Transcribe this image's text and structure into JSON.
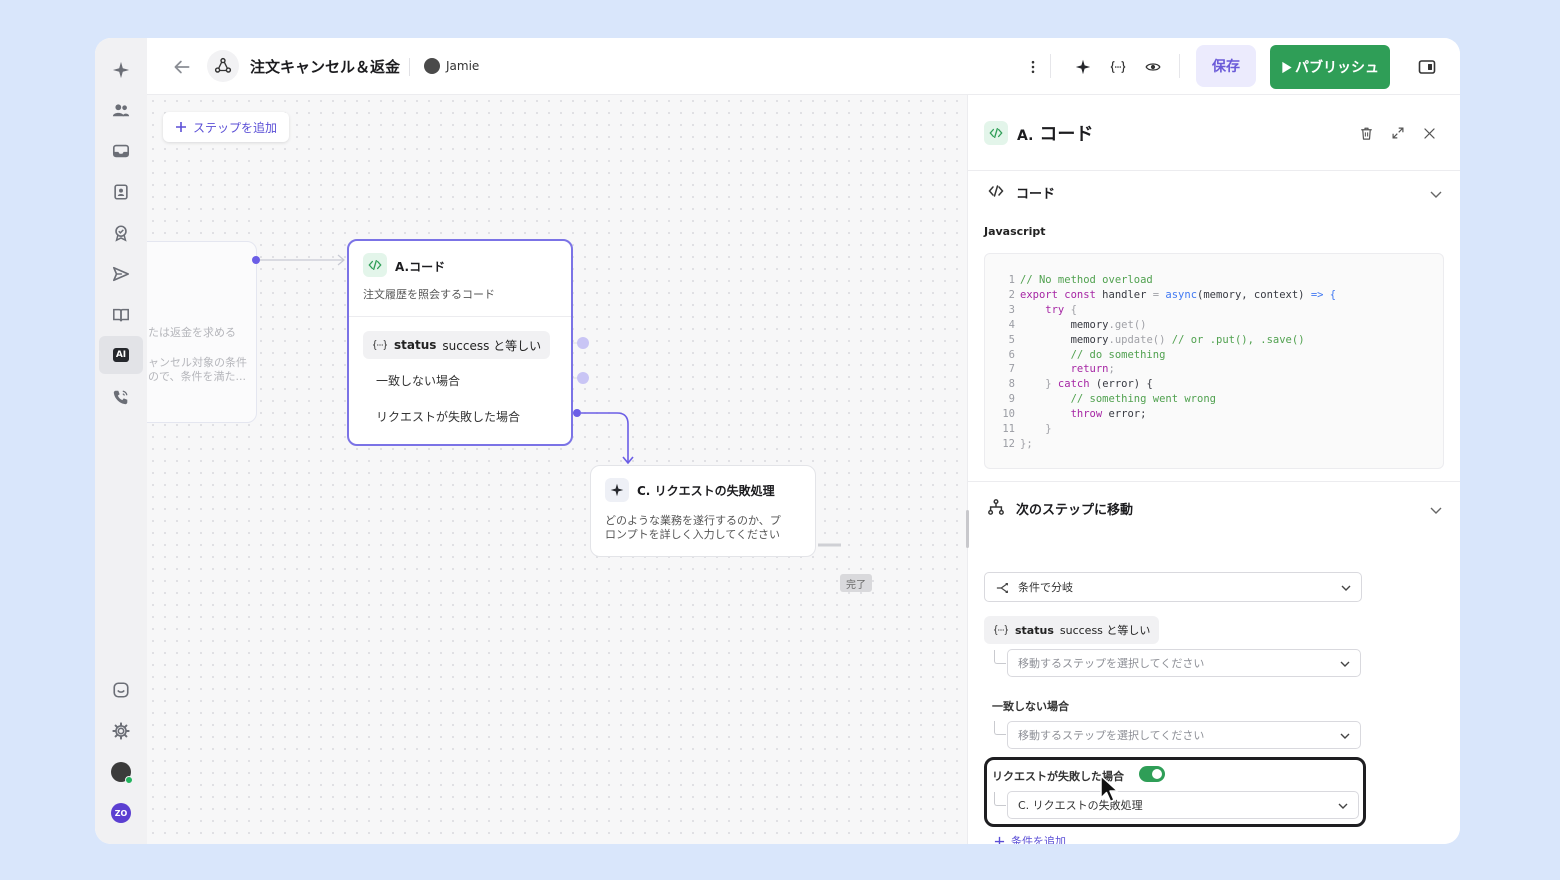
{
  "header": {
    "title": "注文キャンセル＆返金",
    "owner": "Jamie",
    "save_label": "保存",
    "publish_label": "パブリッシュ"
  },
  "sidebar": {
    "items": [
      {
        "icon": "sparkle-icon"
      },
      {
        "icon": "users-icon"
      },
      {
        "icon": "inbox-icon"
      },
      {
        "icon": "contact-card-icon"
      },
      {
        "icon": "badge-check-icon"
      },
      {
        "icon": "send-icon"
      },
      {
        "icon": "book-icon"
      },
      {
        "icon": "ai-icon",
        "label": "AI",
        "active": true
      },
      {
        "icon": "phone-icon"
      }
    ],
    "bottom": [
      {
        "icon": "chat-bubble-icon"
      },
      {
        "icon": "gear-icon"
      },
      {
        "icon": "avatar"
      },
      {
        "icon": "workspace-logo",
        "label": "ZO"
      }
    ]
  },
  "canvas": {
    "add_step_label": "ステップを追加",
    "ghost_node": {
      "line1": "たは返金を求める",
      "line2": "ャンセル対象の条件",
      "line3": "ので、条件を満た..."
    },
    "node_a": {
      "letter": "A.",
      "title": "コード",
      "description": "注文履歴を照会するコード",
      "condition_field": "status",
      "condition_text": "success と等しい",
      "else_label": "一致しない場合",
      "fail_label": "リクエストが失敗した場合"
    },
    "node_c": {
      "letter": "C.",
      "title": "リクエストの失敗処理",
      "description_line1": "どのような業務を遂行するのか、プ",
      "description_line2": "ロンプトを詳しく入力してください"
    },
    "done_tag": "完了"
  },
  "panel": {
    "letter": "A.",
    "title": "コード",
    "code_section_title": "コード",
    "language_label": "Javascript",
    "code_lines": [
      "1",
      "2",
      "3",
      "4",
      "5",
      "6",
      "7",
      "8",
      "9",
      "10",
      "11",
      "12"
    ],
    "code": {
      "l1": "// No method overload",
      "l2_kw1": "export const",
      "l2_name": " handler ",
      "l2_eq": "=",
      "l2_async": " async",
      "l2_args": "(memory, context)",
      "l2_arrow": " => {",
      "l3_try": "    try",
      "l3_brace": " {",
      "l4_obj": "        memory",
      "l4_fn": ".get",
      "l4_end": "()",
      "l5_obj": "        memory",
      "l5_fn": ".update",
      "l5_end": "()",
      "l5_cm": " // or .put(), .save()",
      "l6": "        // do something",
      "l7_kw": "        return",
      "l7_end": ";",
      "l8_a": "    }",
      "l8_kw": " catch",
      "l8_b": " (error) {",
      "l9": "        // something went wrong",
      "l10_kw": "        throw",
      "l10_b": " error;",
      "l11": "    }",
      "l12": "};"
    },
    "next_section_title": "次のステップに移動",
    "branch_mode": "条件で分岐",
    "condition_field": "status",
    "condition_text": "success と等しい",
    "select_placeholder": "移動するステップを選択してください",
    "else_label": "一致しない場合",
    "fail_label": "リクエストが失敗した場合",
    "fail_toggle_on": true,
    "fail_target": "C. リクエストの失敗処理",
    "add_condition_label": "条件を追加"
  },
  "colors": {
    "accent": "#6b5ee6",
    "publish": "#2f9e57",
    "save_bg": "#ecebfd",
    "page_bg": "#d9e6fb"
  }
}
